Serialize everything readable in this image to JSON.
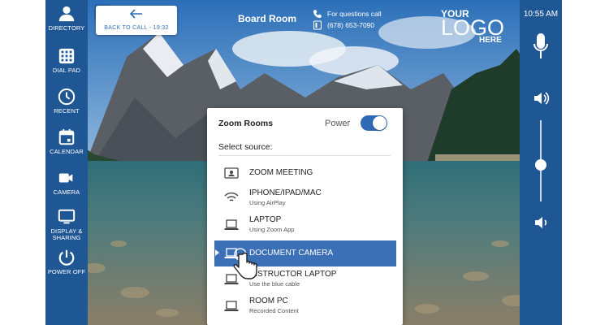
{
  "sidebar": {
    "items": [
      {
        "label": "DIRECTORY",
        "icon": "person-icon"
      },
      {
        "label": "DIAL PAD",
        "icon": "dialpad-icon"
      },
      {
        "label": "RECENT",
        "icon": "clock-icon"
      },
      {
        "label": "CALENDAR",
        "icon": "calendar-icon"
      },
      {
        "label": "CAMERA",
        "icon": "camera-icon"
      },
      {
        "label": "DISPLAY &\nSHARING",
        "icon": "display-icon"
      },
      {
        "label": "POWER OFF",
        "icon": "power-icon"
      }
    ]
  },
  "header": {
    "back_button_label": "BACK TO CALL - 19:32",
    "room_name": "Board Room",
    "help_text": "For questions call",
    "help_phone": "(678) 653-7090",
    "logo_line1": "YOUR",
    "logo_line2": "LOGO",
    "logo_line3": "HERE"
  },
  "rightbar": {
    "time": "10:55 AM",
    "volume_level": 0.45
  },
  "panel": {
    "title": "Zoom Rooms",
    "power_label": "Power",
    "power_on": true,
    "select_label": "Select source:",
    "sources": [
      {
        "label": "ZOOM MEETING",
        "sub": "",
        "icon": "zoom-meeting-icon"
      },
      {
        "label": "IPHONE/IPAD/MAC",
        "sub": "Using AirPlay",
        "icon": "wifi-icon"
      },
      {
        "label": "LAPTOP",
        "sub": "Using Zoom App",
        "icon": "laptop-icon"
      },
      {
        "label": "DOCUMENT CAMERA",
        "sub": "",
        "icon": "document-camera-icon",
        "selected": true
      },
      {
        "label": "INSTRUCTOR LAPTOP",
        "sub": "Use the blue cable",
        "icon": "laptop-icon"
      },
      {
        "label": "ROOM PC",
        "sub": "Recorded Content",
        "icon": "monitor-icon"
      }
    ]
  },
  "colors": {
    "sidebar_bg": "#1f5694",
    "accent": "#3b6fb6",
    "link": "#2f6ab5"
  }
}
